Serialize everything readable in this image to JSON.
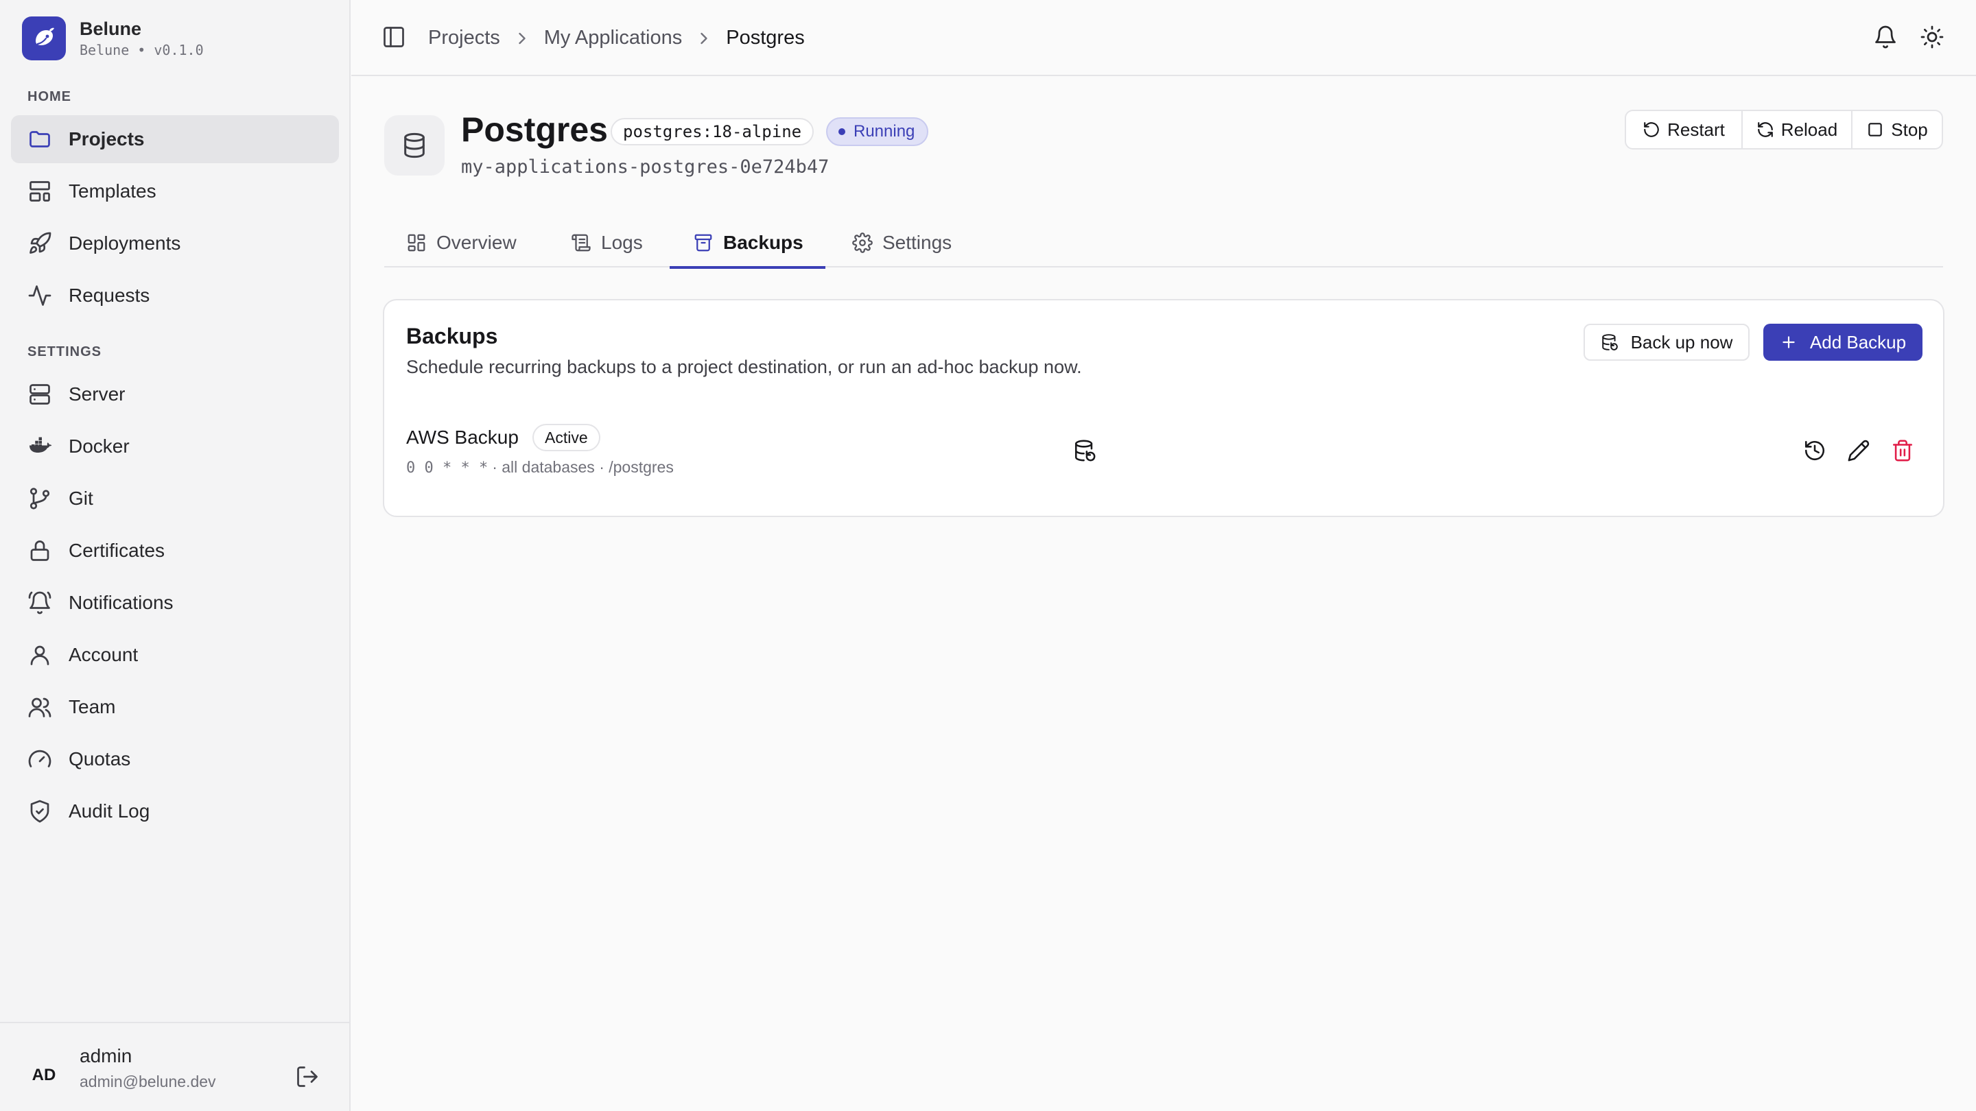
{
  "brand": {
    "name": "Belune",
    "subtitle": "Belune • v0.1.0"
  },
  "sidebar": {
    "home_label": "HOME",
    "home_items": [
      {
        "label": "Projects",
        "icon": "folder-icon",
        "active": true
      },
      {
        "label": "Templates",
        "icon": "layout-icon"
      },
      {
        "label": "Deployments",
        "icon": "rocket-icon"
      },
      {
        "label": "Requests",
        "icon": "activity-icon"
      }
    ],
    "settings_label": "SETTINGS",
    "settings_items": [
      {
        "label": "Server",
        "icon": "server-icon"
      },
      {
        "label": "Docker",
        "icon": "docker-icon"
      },
      {
        "label": "Git",
        "icon": "git-branch-icon"
      },
      {
        "label": "Certificates",
        "icon": "lock-icon"
      },
      {
        "label": "Notifications",
        "icon": "bell-ring-icon"
      },
      {
        "label": "Account",
        "icon": "user-icon"
      },
      {
        "label": "Team",
        "icon": "users-icon"
      },
      {
        "label": "Quotas",
        "icon": "gauge-icon"
      },
      {
        "label": "Audit Log",
        "icon": "shield-check-icon"
      }
    ]
  },
  "user": {
    "initials": "AD",
    "name": "admin",
    "email": "admin@belune.dev"
  },
  "breadcrumb": [
    "Projects",
    "My Applications",
    "Postgres"
  ],
  "service": {
    "title": "Postgres",
    "image": "postgres:18-alpine",
    "status": "Running",
    "container_id": "my-applications-postgres-0e724b47"
  },
  "actions": {
    "restart": "Restart",
    "reload": "Reload",
    "stop": "Stop"
  },
  "tabs": [
    "Overview",
    "Logs",
    "Backups",
    "Settings"
  ],
  "active_tab": "Backups",
  "backups_card": {
    "title": "Backups",
    "description": "Schedule recurring backups to a project destination, or run an ad-hoc backup now.",
    "back_up_now": "Back up now",
    "add_backup": "Add Backup",
    "items": [
      {
        "name": "AWS Backup",
        "status": "Active",
        "cron": "0 0 * * *",
        "meta": "· all databases · /postgres"
      }
    ]
  },
  "colors": {
    "accent": "#3b3fb6",
    "danger": "#e11d48",
    "sidebar_bg": "#f4f4f5",
    "page_bg": "#fafafa"
  }
}
